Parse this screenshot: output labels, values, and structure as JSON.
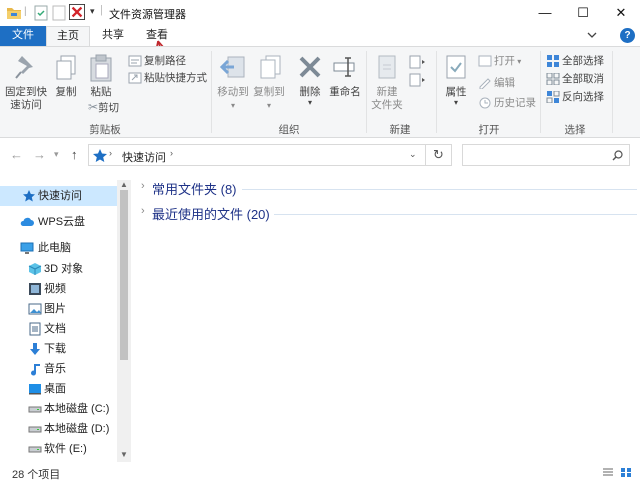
{
  "window": {
    "title": "文件资源管理器",
    "minimize": "—",
    "maximize": "☐",
    "close": "✕",
    "help": "?"
  },
  "tabs": [
    "文件",
    "主页",
    "共享",
    "查看"
  ],
  "ribbon": {
    "clipboard": {
      "pin": "固定到快\n速访问",
      "copy": "复制",
      "paste": "粘贴",
      "copy_path": "复制路径",
      "paste_shortcut": "粘贴快捷方式",
      "cut": "剪切",
      "label": "剪贴板"
    },
    "organize": {
      "move_to": "移动到",
      "copy_to": "复制到",
      "delete": "删除",
      "rename": "重命名",
      "label": "组织"
    },
    "new": {
      "new_folder": "新建\n文件夹",
      "label": "新建"
    },
    "open": {
      "properties": "属性",
      "open": "打开",
      "edit": "编辑",
      "history": "历史记录",
      "label": "打开"
    },
    "select": {
      "select_all": "全部选择",
      "select_none": "全部取消",
      "invert": "反向选择",
      "label": "选择"
    }
  },
  "address": {
    "path": "快速访问",
    "search_placeholder": ""
  },
  "nav": [
    {
      "label": "快速访问",
      "icon": "star-icon"
    },
    {
      "label": "WPS云盘",
      "icon": "cloud-icon"
    },
    {
      "label": "此电脑",
      "icon": "computer-icon"
    },
    {
      "label": "3D 对象",
      "icon": "3d-objects-icon"
    },
    {
      "label": "视频",
      "icon": "video-icon"
    },
    {
      "label": "图片",
      "icon": "pictures-icon"
    },
    {
      "label": "文档",
      "icon": "documents-icon"
    },
    {
      "label": "下载",
      "icon": "download-icon"
    },
    {
      "label": "音乐",
      "icon": "music-icon"
    },
    {
      "label": "桌面",
      "icon": "desktop-icon"
    },
    {
      "label": "本地磁盘 (C:)",
      "icon": "drive-icon"
    },
    {
      "label": "本地磁盘 (D:)",
      "icon": "drive-icon"
    },
    {
      "label": "软件 (E:)",
      "icon": "drive-icon"
    }
  ],
  "groups": [
    {
      "label": "常用文件夹 (8)"
    },
    {
      "label": "最近使用的文件 (20)"
    }
  ],
  "status": {
    "count": "28 个项目"
  },
  "colors": {
    "accent": "#1e6fc4",
    "selected": "#cce8ff",
    "group_text": "#1e3287",
    "annotation_arrow": "#c0282d"
  }
}
